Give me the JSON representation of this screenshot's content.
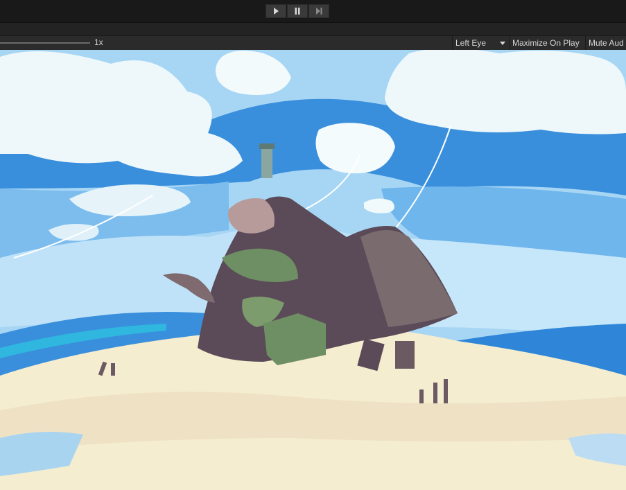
{
  "toolbar": {
    "scale_label": "1x",
    "eye_dropdown": "Left Eye",
    "maximize_label": "Maximize On Play",
    "mute_label": "Mute Aud"
  },
  "playback": {
    "play_icon": "play-icon",
    "pause_icon": "pause-icon",
    "step_icon": "step-icon"
  },
  "colors": {
    "sky_light": "#a7d6f5",
    "sky_mid": "#5aa8e6",
    "sky_deep": "#2f86d8",
    "sand": "#f5edcf",
    "rock": "#5b4a58",
    "moss": "#6e8f63"
  }
}
